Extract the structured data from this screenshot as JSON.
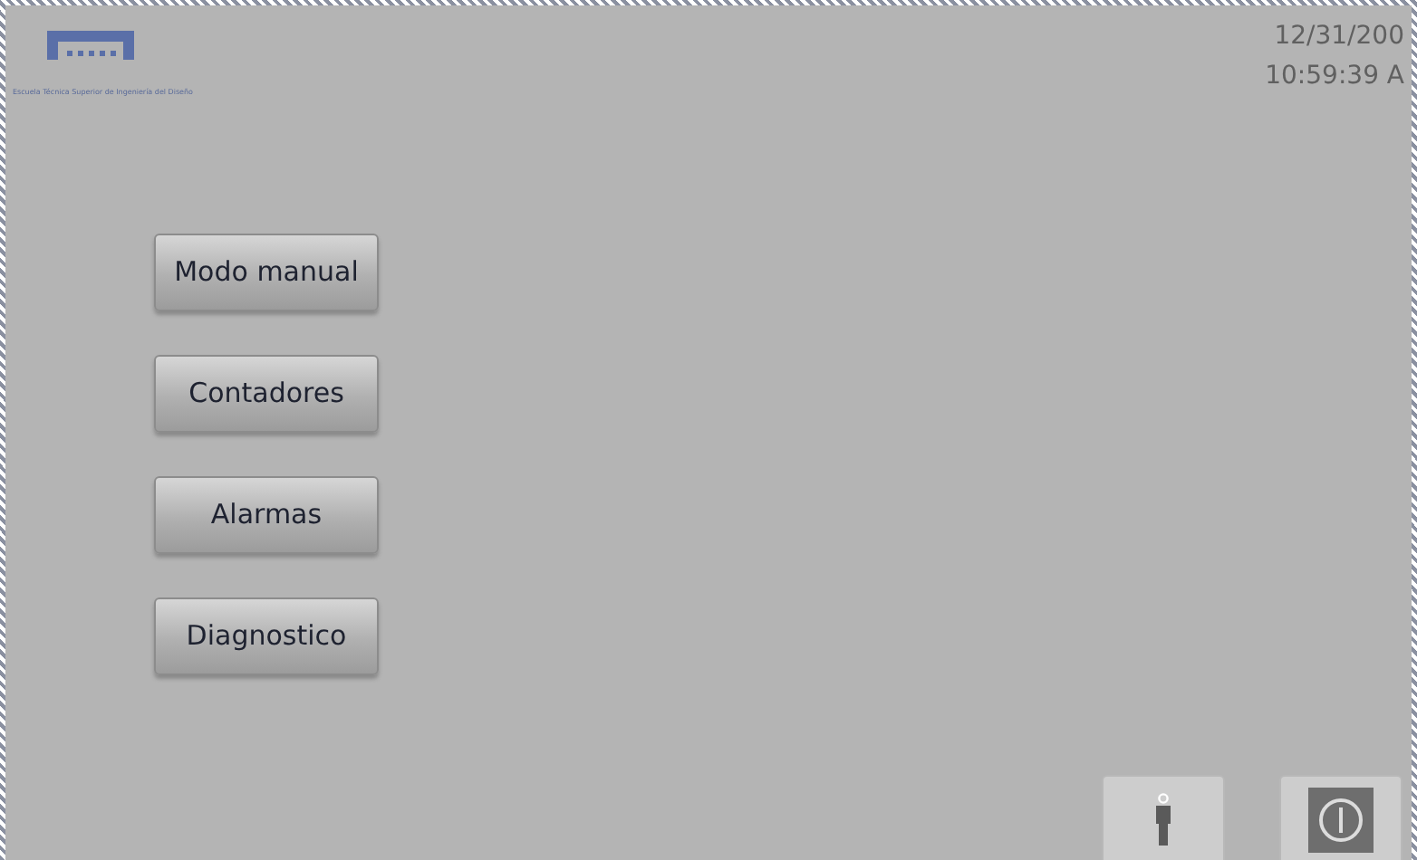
{
  "logo": {
    "caption": "Escuela Técnica Superior de Ingeniería del Diseño"
  },
  "datetime": {
    "date": "12/31/200",
    "time": "10:59:39 A"
  },
  "menu_buttons": [
    {
      "label": "Modo manual"
    },
    {
      "label": "Contadores"
    },
    {
      "label": "Alarmas"
    },
    {
      "label": "Diagnostico"
    }
  ],
  "footer_buttons": [
    {
      "kind": "user"
    },
    {
      "kind": "power"
    }
  ]
}
